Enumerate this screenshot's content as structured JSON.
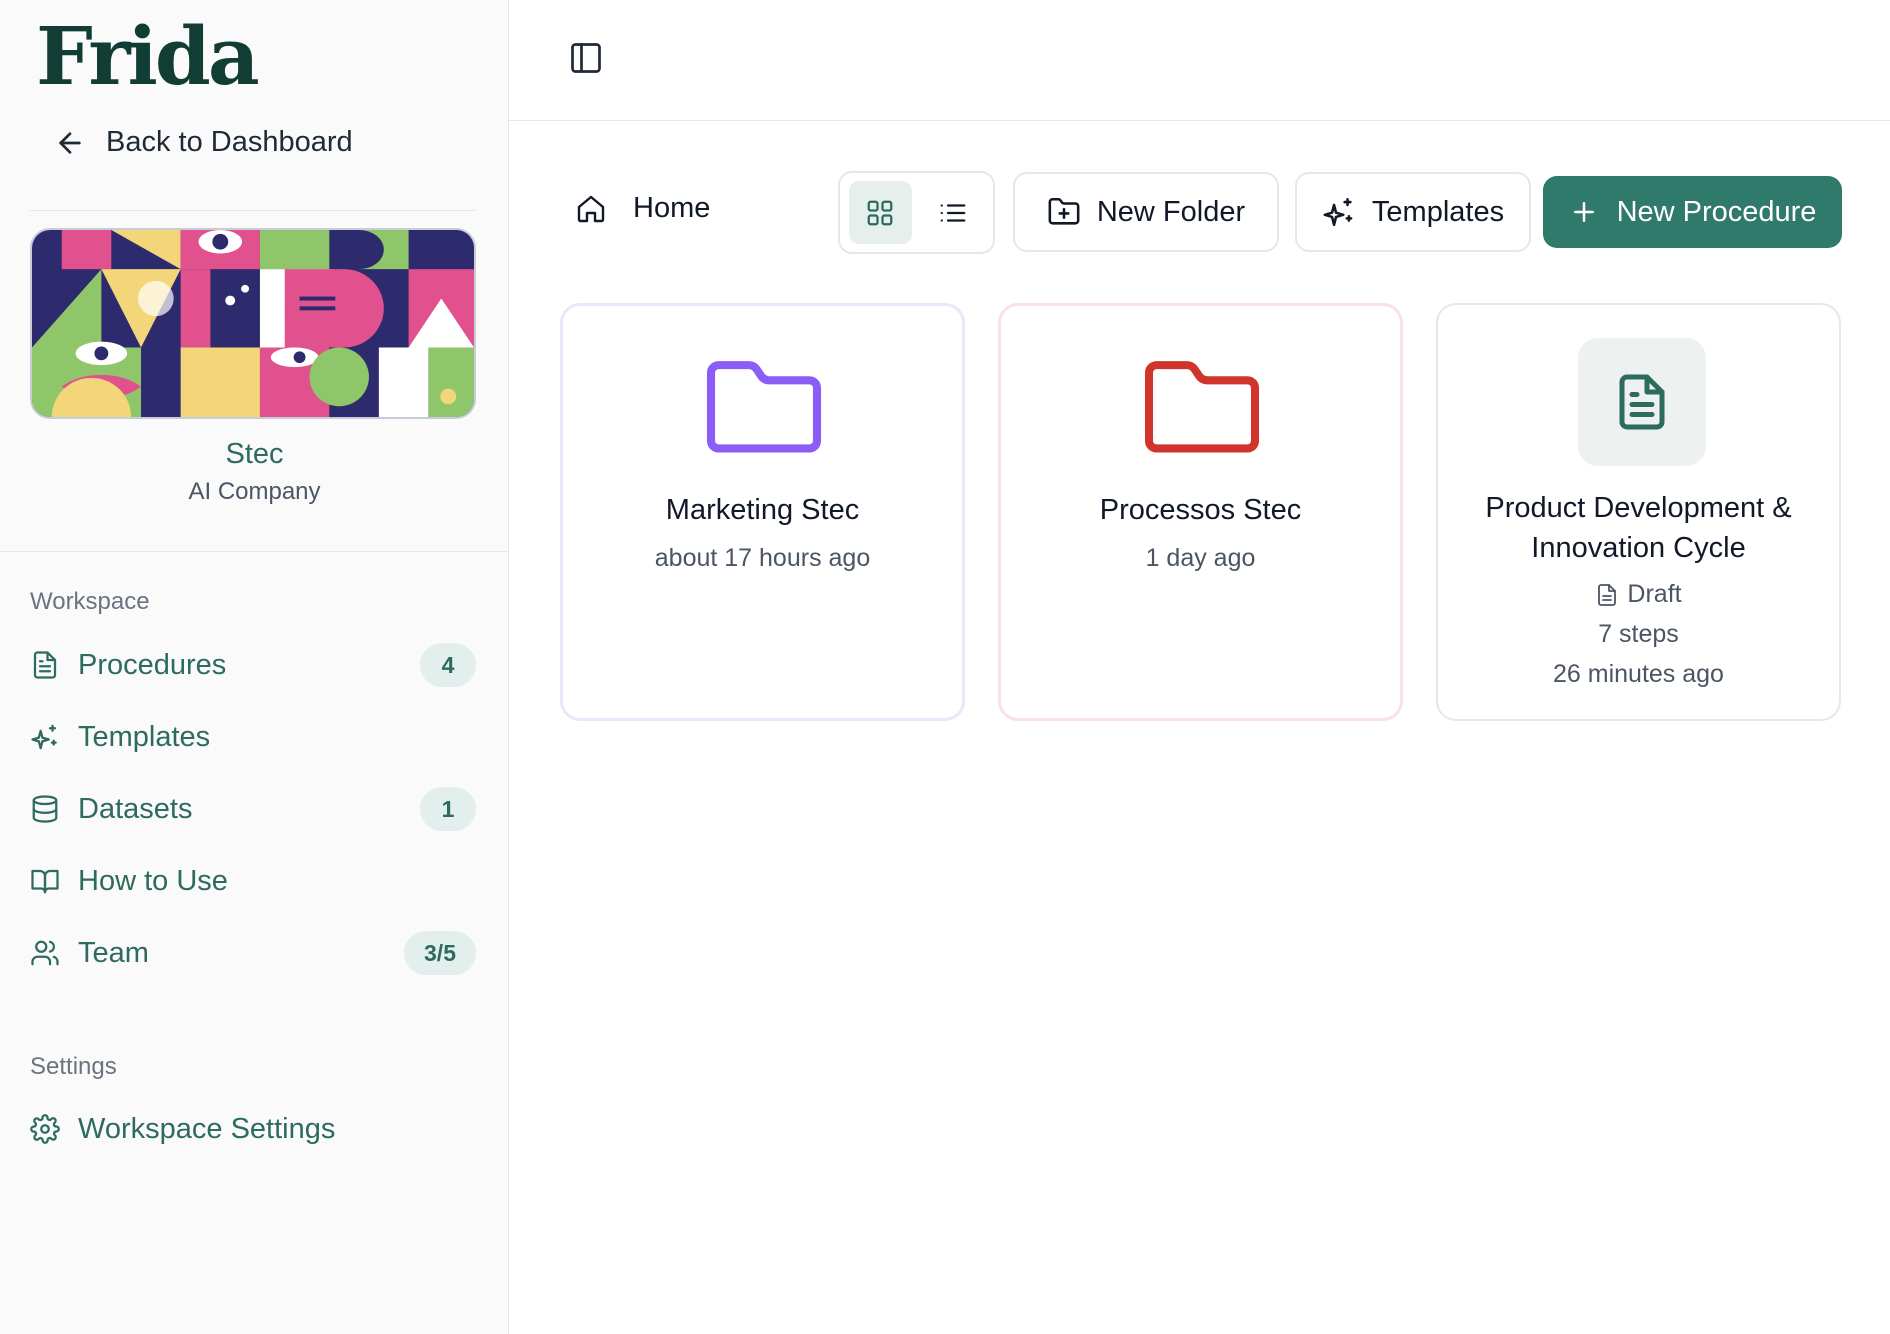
{
  "sidebar": {
    "logo": "Frida",
    "back_label": "Back to Dashboard",
    "org": {
      "name": "Stec",
      "type": "AI Company"
    },
    "workspace_label": "Workspace",
    "items": [
      {
        "label": "Procedures",
        "badge": "4",
        "icon": "file-text-icon"
      },
      {
        "label": "Templates",
        "badge": "",
        "icon": "sparkles-icon"
      },
      {
        "label": "Datasets",
        "badge": "1",
        "icon": "database-icon"
      },
      {
        "label": "How to Use",
        "badge": "",
        "icon": "book-open-icon"
      },
      {
        "label": "Team",
        "badge": "3/5",
        "icon": "users-icon"
      }
    ],
    "settings_label": "Settings",
    "settings_items": [
      {
        "label": "Workspace Settings",
        "icon": "gear-icon"
      }
    ]
  },
  "toolbar": {
    "breadcrumb": "Home",
    "new_folder_label": "New Folder",
    "templates_label": "Templates",
    "new_procedure_label": "New Procedure",
    "view_mode": "grid"
  },
  "cards": [
    {
      "type": "folder",
      "title": "Marketing Stec",
      "time": "about 17 hours ago",
      "color": "#8b5cf6"
    },
    {
      "type": "folder",
      "title": "Processos Stec",
      "time": "1 day ago",
      "color": "#d0342c"
    },
    {
      "type": "procedure",
      "title_line1": "Product Development &",
      "title_line2": "Innovation Cycle",
      "status": "Draft",
      "steps": "7 steps",
      "time": "26 minutes ago",
      "color": "#2d6b5f"
    }
  ],
  "colors": {
    "brand": "#113d34",
    "accent": "#2f7a6b",
    "nav_text": "#2d6b5f"
  }
}
